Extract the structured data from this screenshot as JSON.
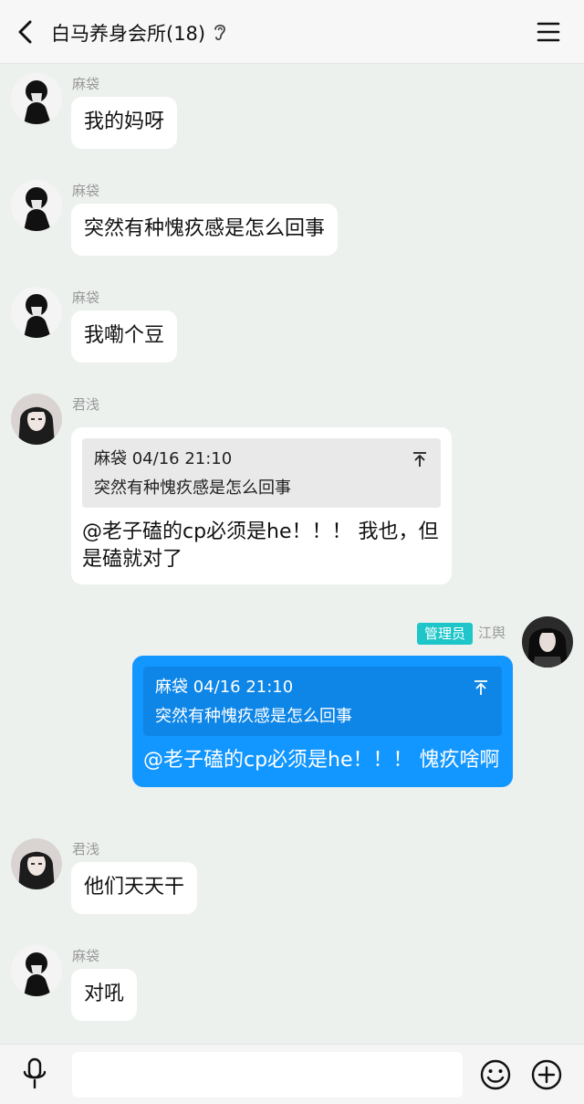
{
  "header": {
    "title": "白马养身会所(18)"
  },
  "messages": [
    {
      "nick": "麻袋",
      "text": "我的妈呀"
    },
    {
      "nick": "麻袋",
      "text": "突然有种愧疚感是怎么回事"
    },
    {
      "nick": "麻袋",
      "text": "我嘞个豆"
    },
    {
      "nick": "君浅",
      "quote_head": "麻袋 04/16 21:10",
      "quote_text": "突然有种愧疚感是怎么回事",
      "text": "@老子磕的cp必须是he！！！ 我也，但是磕就对了"
    },
    {
      "nick": "江舆",
      "badge": "管理员",
      "quote_head": "麻袋 04/16 21:10",
      "quote_text": "突然有种愧疚感是怎么回事",
      "text": "@老子磕的cp必须是he！！！ 愧疚啥啊"
    },
    {
      "nick": "君浅",
      "text": "他们天天干"
    },
    {
      "nick": "麻袋",
      "text": "对吼"
    }
  ],
  "colors": {
    "self_bubble": "#1296ff",
    "admin_badge": "#1ec6c9",
    "chat_bg": "#edf1ee"
  },
  "icons": [
    "back-arrow-icon",
    "ear-icon",
    "menu-icon",
    "quote-jump-icon",
    "microphone-icon",
    "emoji-icon",
    "plus-icon"
  ]
}
